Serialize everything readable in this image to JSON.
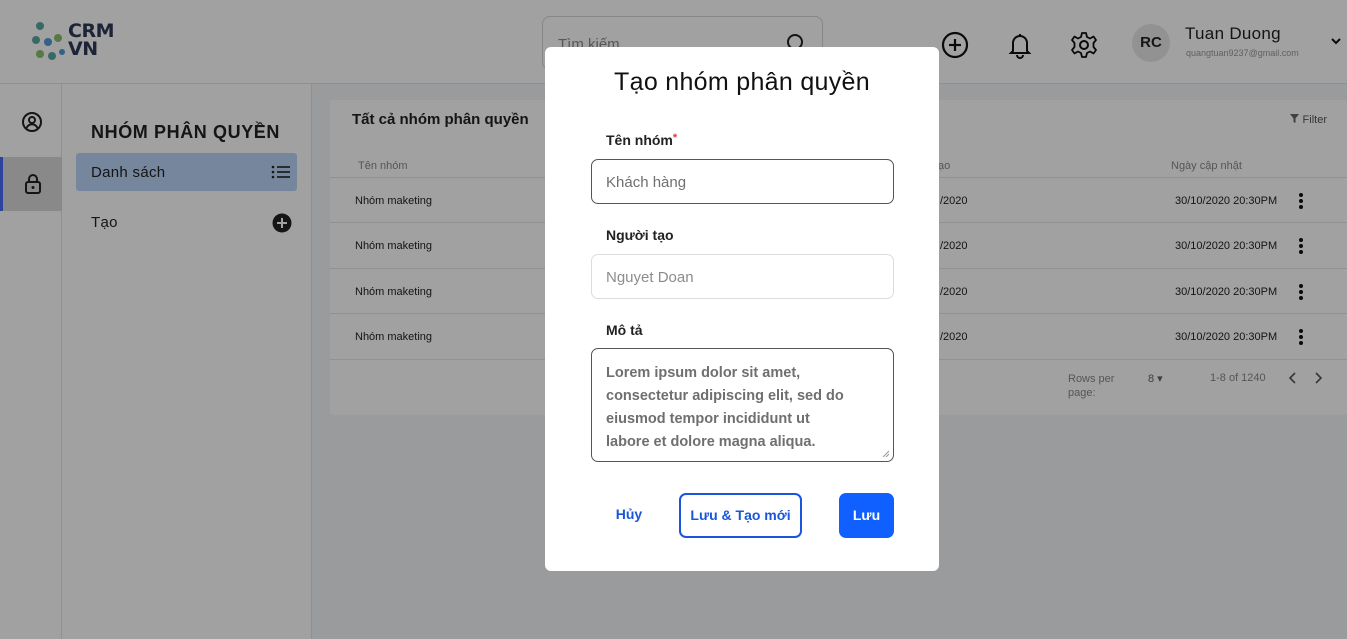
{
  "app": {
    "logo_line1": "CRM",
    "logo_line2": "VN"
  },
  "header": {
    "search_placeholder": "Tìm kiếm",
    "user": {
      "initials": "RC",
      "name": "Tuan Duong",
      "email": "quangtuan9237@gmail.com"
    }
  },
  "rail": {
    "items": [
      "user-circle-icon",
      "lock-icon"
    ],
    "active_index": 1
  },
  "sidebar": {
    "title": "NHÓM PHÂN QUYỀN",
    "items": [
      {
        "label": "Danh sách",
        "icon": "list-icon"
      },
      {
        "label": "Tạo",
        "icon": "plus-circle-icon"
      }
    ]
  },
  "content": {
    "title": "Tất cả nhóm phân quyền",
    "filter_label": "Filter",
    "columns": [
      "Tên nhóm",
      "ạo",
      "Ngày cập nhật"
    ],
    "rows": [
      {
        "name": "Nhóm maketing",
        "created": "/2020",
        "updated": "30/10/2020 20:30PM"
      },
      {
        "name": "Nhóm maketing",
        "created": "/2020",
        "updated": "30/10/2020 20:30PM"
      },
      {
        "name": "Nhóm maketing",
        "created": "/2020",
        "updated": "30/10/2020 20:30PM"
      },
      {
        "name": "Nhóm maketing",
        "created": "/2020",
        "updated": "30/10/2020 20:30PM"
      }
    ],
    "pagination": {
      "rows_per_page_label_1": "Rows per",
      "rows_per_page_label_2": "page:",
      "rows_per_page": "8 ▾",
      "range": "1-8 of 1240"
    }
  },
  "modal": {
    "title": "Tạo nhóm phân quyền",
    "group_name_label": "Tên nhóm",
    "required_mark": "*",
    "group_name_value": "Khách hàng",
    "creator_label": "Người tạo",
    "creator_value": "Nguyet Doan",
    "description_label": "Mô tả",
    "description_value": "Lorem ipsum dolor sit amet, consectetur adipiscing elit, sed do eiusmod tempor incididunt ut labore et dolore magna aliqua.",
    "cancel_label": "Hủy",
    "save_new_label": "Lưu & Tạo mới",
    "save_label": "Lưu"
  },
  "colors": {
    "accent": "#1060ff",
    "active_nav": "#bcd4f7",
    "rail_indicator": "#4a6cf7",
    "required": "#e53935"
  }
}
